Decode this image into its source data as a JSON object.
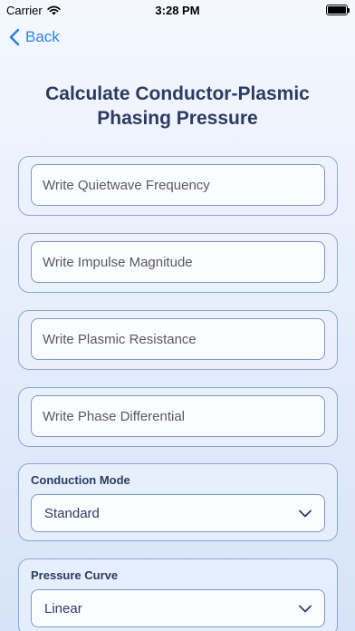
{
  "status_bar": {
    "carrier": "Carrier",
    "time": "3:28 PM"
  },
  "nav": {
    "back_label": "Back"
  },
  "title": "Calculate Conductor-Plasmic Phasing Pressure",
  "inputs": [
    {
      "placeholder": "Write Quietwave Frequency",
      "value": ""
    },
    {
      "placeholder": "Write Impulse Magnitude",
      "value": ""
    },
    {
      "placeholder": "Write Plasmic Resistance",
      "value": ""
    },
    {
      "placeholder": "Write Phase Differential",
      "value": ""
    }
  ],
  "selects": [
    {
      "label": "Conduction Mode",
      "selected": "Standard"
    },
    {
      "label": "Pressure Curve",
      "selected": "Linear"
    }
  ],
  "colors": {
    "accent": "#2f80ed",
    "title": "#2d3b63",
    "border": "#8aa6d6"
  }
}
